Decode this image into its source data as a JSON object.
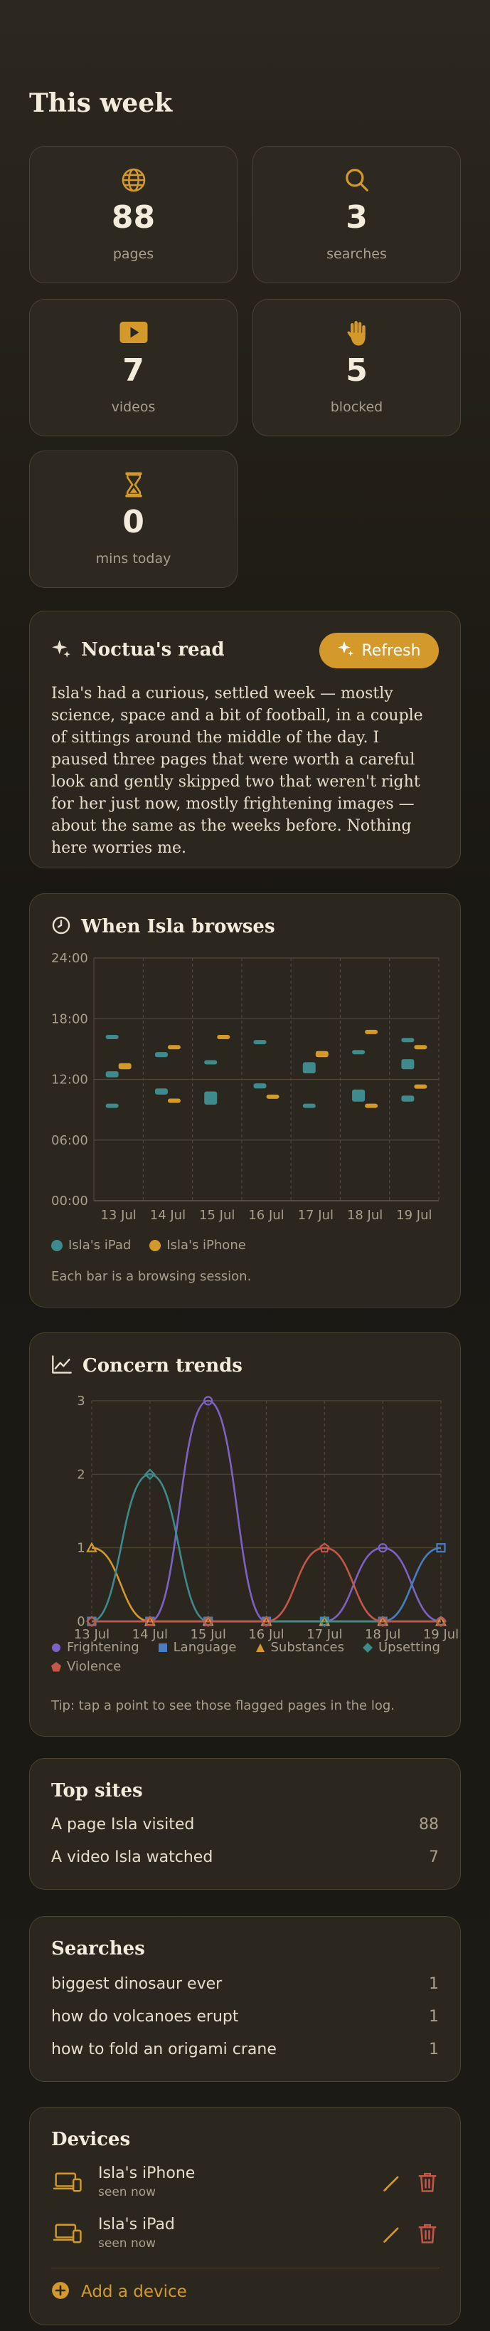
{
  "heading": "This week",
  "stats": [
    {
      "icon": "globe-icon",
      "value": "88",
      "label": "pages"
    },
    {
      "icon": "search-icon",
      "value": "3",
      "label": "searches"
    },
    {
      "icon": "play-icon",
      "value": "7",
      "label": "videos"
    },
    {
      "icon": "hand-icon",
      "value": "5",
      "label": "blocked"
    },
    {
      "icon": "hourglass-icon",
      "value": "0",
      "label": "mins today"
    }
  ],
  "summary": {
    "title": "Noctua's read",
    "refresh_label": "Refresh",
    "text": "Isla's had a curious, settled week — mostly science, space and a bit of football, in a couple of sittings around the middle of the day. I paused three pages that were worth a careful look and gently skipped two that weren't right for her just now, mostly frightening images — about the same as the weeks before. Nothing here worries me."
  },
  "browse": {
    "title": "When Isla browses",
    "note": "Each bar is a browsing session."
  },
  "trends": {
    "title": "Concern trends",
    "tip": "Tip: tap a point to see those flagged pages in the log."
  },
  "chart_data": [
    {
      "type": "scatter",
      "title": "When Isla browses",
      "categories": [
        "13 Jul",
        "14 Jul",
        "15 Jul",
        "16 Jul",
        "17 Jul",
        "18 Jul",
        "19 Jul"
      ],
      "y_ticks": [
        "24:00",
        "18:00",
        "12:00",
        "06:00",
        "00:00"
      ],
      "ylim": [
        0,
        24
      ],
      "legend_position": "bottom-left",
      "series": [
        {
          "name": "Isla's iPad",
          "color": "#3f8a8c",
          "sessions": [
            {
              "day": 0,
              "start": 16.0,
              "end": 16.4
            },
            {
              "day": 0,
              "start": 12.2,
              "end": 12.8
            },
            {
              "day": 0,
              "start": 9.2,
              "end": 9.6
            },
            {
              "day": 1,
              "start": 14.2,
              "end": 14.7
            },
            {
              "day": 1,
              "start": 10.5,
              "end": 11.1
            },
            {
              "day": 2,
              "start": 13.5,
              "end": 13.9
            },
            {
              "day": 2,
              "start": 9.5,
              "end": 10.8
            },
            {
              "day": 3,
              "start": 15.5,
              "end": 15.9
            },
            {
              "day": 3,
              "start": 11.1,
              "end": 11.6
            },
            {
              "day": 4,
              "start": 12.6,
              "end": 13.7
            },
            {
              "day": 4,
              "start": 9.2,
              "end": 9.6
            },
            {
              "day": 5,
              "start": 14.5,
              "end": 14.9
            },
            {
              "day": 5,
              "start": 9.8,
              "end": 11.0
            },
            {
              "day": 6,
              "start": 15.8,
              "end": 16.1
            },
            {
              "day": 6,
              "start": 13.0,
              "end": 14.0
            },
            {
              "day": 6,
              "start": 9.8,
              "end": 10.4
            }
          ]
        },
        {
          "name": "Isla's iPhone",
          "color": "#d39a2b",
          "sessions": [
            {
              "day": 0,
              "start": 13.0,
              "end": 13.6
            },
            {
              "day": 1,
              "start": 15.0,
              "end": 15.4
            },
            {
              "day": 1,
              "start": 9.7,
              "end": 10.1
            },
            {
              "day": 2,
              "start": 16.0,
              "end": 16.4
            },
            {
              "day": 3,
              "start": 10.1,
              "end": 10.5
            },
            {
              "day": 4,
              "start": 14.2,
              "end": 14.8
            },
            {
              "day": 5,
              "start": 16.6,
              "end": 16.9
            },
            {
              "day": 5,
              "start": 9.2,
              "end": 9.6
            },
            {
              "day": 6,
              "start": 15.1,
              "end": 15.4
            },
            {
              "day": 6,
              "start": 11.1,
              "end": 11.5
            }
          ]
        }
      ]
    },
    {
      "type": "line",
      "title": "Concern trends",
      "categories": [
        "13 Jul",
        "14 Jul",
        "15 Jul",
        "16 Jul",
        "17 Jul",
        "18 Jul",
        "19 Jul"
      ],
      "ylim": [
        0,
        3
      ],
      "y_ticks": [
        "3",
        "2",
        "1",
        "0"
      ],
      "legend_position": "bottom-left",
      "series": [
        {
          "name": "Frightening",
          "color": "#7b63c4",
          "marker": "circle",
          "values": [
            0,
            0,
            3,
            0,
            0,
            1,
            0
          ]
        },
        {
          "name": "Language",
          "color": "#4a7ec4",
          "marker": "square",
          "values": [
            0,
            0,
            0,
            0,
            0,
            0,
            1
          ]
        },
        {
          "name": "Substances",
          "color": "#d39a2b",
          "marker": "triangle",
          "values": [
            1,
            0,
            0,
            0,
            0,
            0,
            0
          ]
        },
        {
          "name": "Upsetting",
          "color": "#3f8a8c",
          "marker": "diamond",
          "values": [
            0,
            2,
            0,
            0,
            0,
            0,
            0
          ]
        },
        {
          "name": "Violence",
          "color": "#c4564a",
          "marker": "pentagon",
          "values": [
            0,
            0,
            0,
            0,
            1,
            0,
            0
          ]
        }
      ]
    }
  ],
  "top_sites": {
    "title": "Top sites",
    "rows": [
      {
        "label": "A page Isla visited",
        "count": "88"
      },
      {
        "label": "A video Isla watched",
        "count": "7"
      }
    ]
  },
  "searches": {
    "title": "Searches",
    "rows": [
      {
        "label": "biggest dinosaur ever",
        "count": "1"
      },
      {
        "label": "how do volcanoes erupt",
        "count": "1"
      },
      {
        "label": "how to fold an origami crane",
        "count": "1"
      }
    ]
  },
  "devices": {
    "title": "Devices",
    "items": [
      {
        "name": "Isla's iPhone",
        "seen": "seen now"
      },
      {
        "name": "Isla's iPad",
        "seen": "seen now"
      }
    ],
    "add_label": "Add a device"
  },
  "colors": {
    "accent": "#d39a2b",
    "teal": "#3f8a8c",
    "danger": "#c4564a"
  }
}
